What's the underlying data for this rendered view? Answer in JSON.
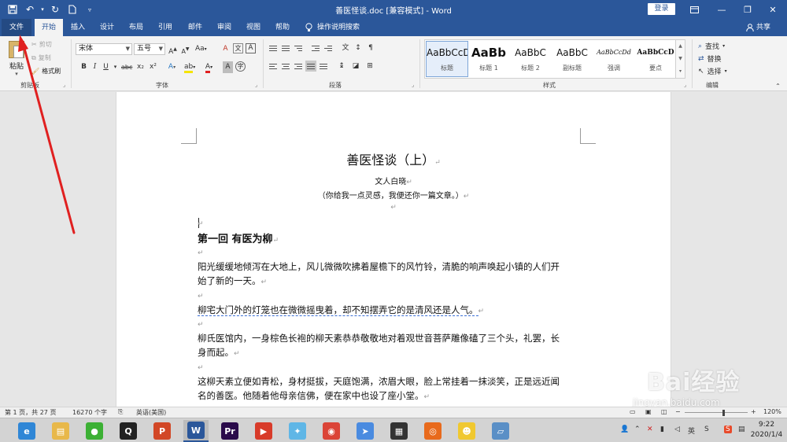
{
  "window": {
    "title": "善医怪谈.doc [兼容模式] - Word",
    "login_label": "登录",
    "qat_icons": [
      "save-icon",
      "undo-icon",
      "redo-icon",
      "new-document-icon",
      "customize-icon"
    ]
  },
  "tabs": [
    "文件",
    "开始",
    "插入",
    "设计",
    "布局",
    "引用",
    "邮件",
    "审阅",
    "视图",
    "帮助"
  ],
  "active_tab": "开始",
  "tell_me": "操作说明搜索",
  "share": "共享",
  "ribbon": {
    "clipboard": {
      "paste": "粘贴",
      "cut": "剪切",
      "copy": "复制",
      "format_painter": "格式刷",
      "label": "剪贴板"
    },
    "font": {
      "font_name": "宋体",
      "font_size": "五号",
      "grow": "A",
      "shrink": "A",
      "case": "Aa",
      "clear": "A",
      "phonetic": "文",
      "border_char": "A",
      "bold": "B",
      "italic": "I",
      "underline": "U",
      "strike": "abc",
      "subscript": "x₂",
      "superscript": "x²",
      "label": "字体"
    },
    "paragraph": {
      "label": "段落"
    },
    "styles": {
      "label": "样式",
      "items": [
        {
          "sample": "AaBbCcDd",
          "name": "标题"
        },
        {
          "sample": "AaBb",
          "name": "标题 1"
        },
        {
          "sample": "AaBbC",
          "name": "标题 2"
        },
        {
          "sample": "AaBbC",
          "name": "副标题"
        },
        {
          "sample": "AaBbCcDd",
          "name": "强调"
        },
        {
          "sample": "AaBbCcD",
          "name": "要点"
        }
      ]
    },
    "editing": {
      "find": "查找",
      "replace": "替换",
      "select": "选择",
      "label": "编辑"
    }
  },
  "document": {
    "title": "善医怪谈（上）",
    "author": "文人白晓",
    "subtitle": "（你给我一点灵感，我便还你一篇文章。）",
    "chapter": "第一回  有医为柳",
    "lines": [
      "阳光缓缓地倾泻在大地上，风儿微微吹拂着屋檐下的风竹铃，清脆的响声唤起小镇的人们开",
      "始了新的一天。",
      "柳宅大门外的灯笼也在微微摇曳着，却不知摆弄它的是清风还是人气。",
      "柳氏医馆内，一身棕色长袍的柳天素恭恭敬敬地对着观世音菩萨雕像磕了三个头，礼罢，长",
      "身而起。",
      "这柳天素立便如青松，身材挺拔，天庭饱满，浓眉大眼，脸上常挂着一抹淡笑，正是远近闻",
      "名的善医。他随着他母亲信佛，便在家中也设了座小堂。"
    ],
    "paragraph_mark": "↵"
  },
  "statusbar": {
    "page": "第 1 页，共 27 页",
    "words": "16270 个字",
    "language": "英语(美国)",
    "zoom": "120%"
  },
  "watermark": {
    "text": "Bai经验",
    "url": "jingyan.baidu.com"
  },
  "taskbar": {
    "apps": [
      {
        "icon": "browser-360-icon",
        "color": "#2f86d6",
        "glyph": "e"
      },
      {
        "icon": "file-explorer-icon",
        "color": "#e8b84a",
        "glyph": "▤"
      },
      {
        "icon": "wechat-icon",
        "color": "#3cb034",
        "glyph": "●"
      },
      {
        "icon": "qq-icon",
        "color": "#222222",
        "glyph": "Q"
      },
      {
        "icon": "powerpoint-icon",
        "color": "#d24726",
        "glyph": "P"
      },
      {
        "icon": "word-icon",
        "color": "#2b579a",
        "glyph": "W"
      },
      {
        "icon": "premiere-icon",
        "color": "#2a0a4a",
        "glyph": "Pr"
      },
      {
        "icon": "media-player-icon",
        "color": "#d83b2a",
        "glyph": "▶"
      },
      {
        "icon": "bird-app-icon",
        "color": "#5fb6e6",
        "glyph": "✦"
      },
      {
        "icon": "chrome-icon",
        "color": "#db4437",
        "glyph": "◉"
      },
      {
        "icon": "paper-plane-icon",
        "color": "#4a8be0",
        "glyph": "➤"
      },
      {
        "icon": "video-editor-icon",
        "color": "#333333",
        "glyph": "▦"
      },
      {
        "icon": "fox-app-icon",
        "color": "#e86a1c",
        "glyph": "◎"
      },
      {
        "icon": "duck-app-icon",
        "color": "#f0c830",
        "glyph": "☻"
      },
      {
        "icon": "notebook-icon",
        "color": "#5a8fc6",
        "glyph": "▱"
      }
    ],
    "time": "9:22",
    "date": "2020/1/4"
  },
  "colors": {
    "accent": "#2b579a",
    "annotation": "#e02020"
  }
}
